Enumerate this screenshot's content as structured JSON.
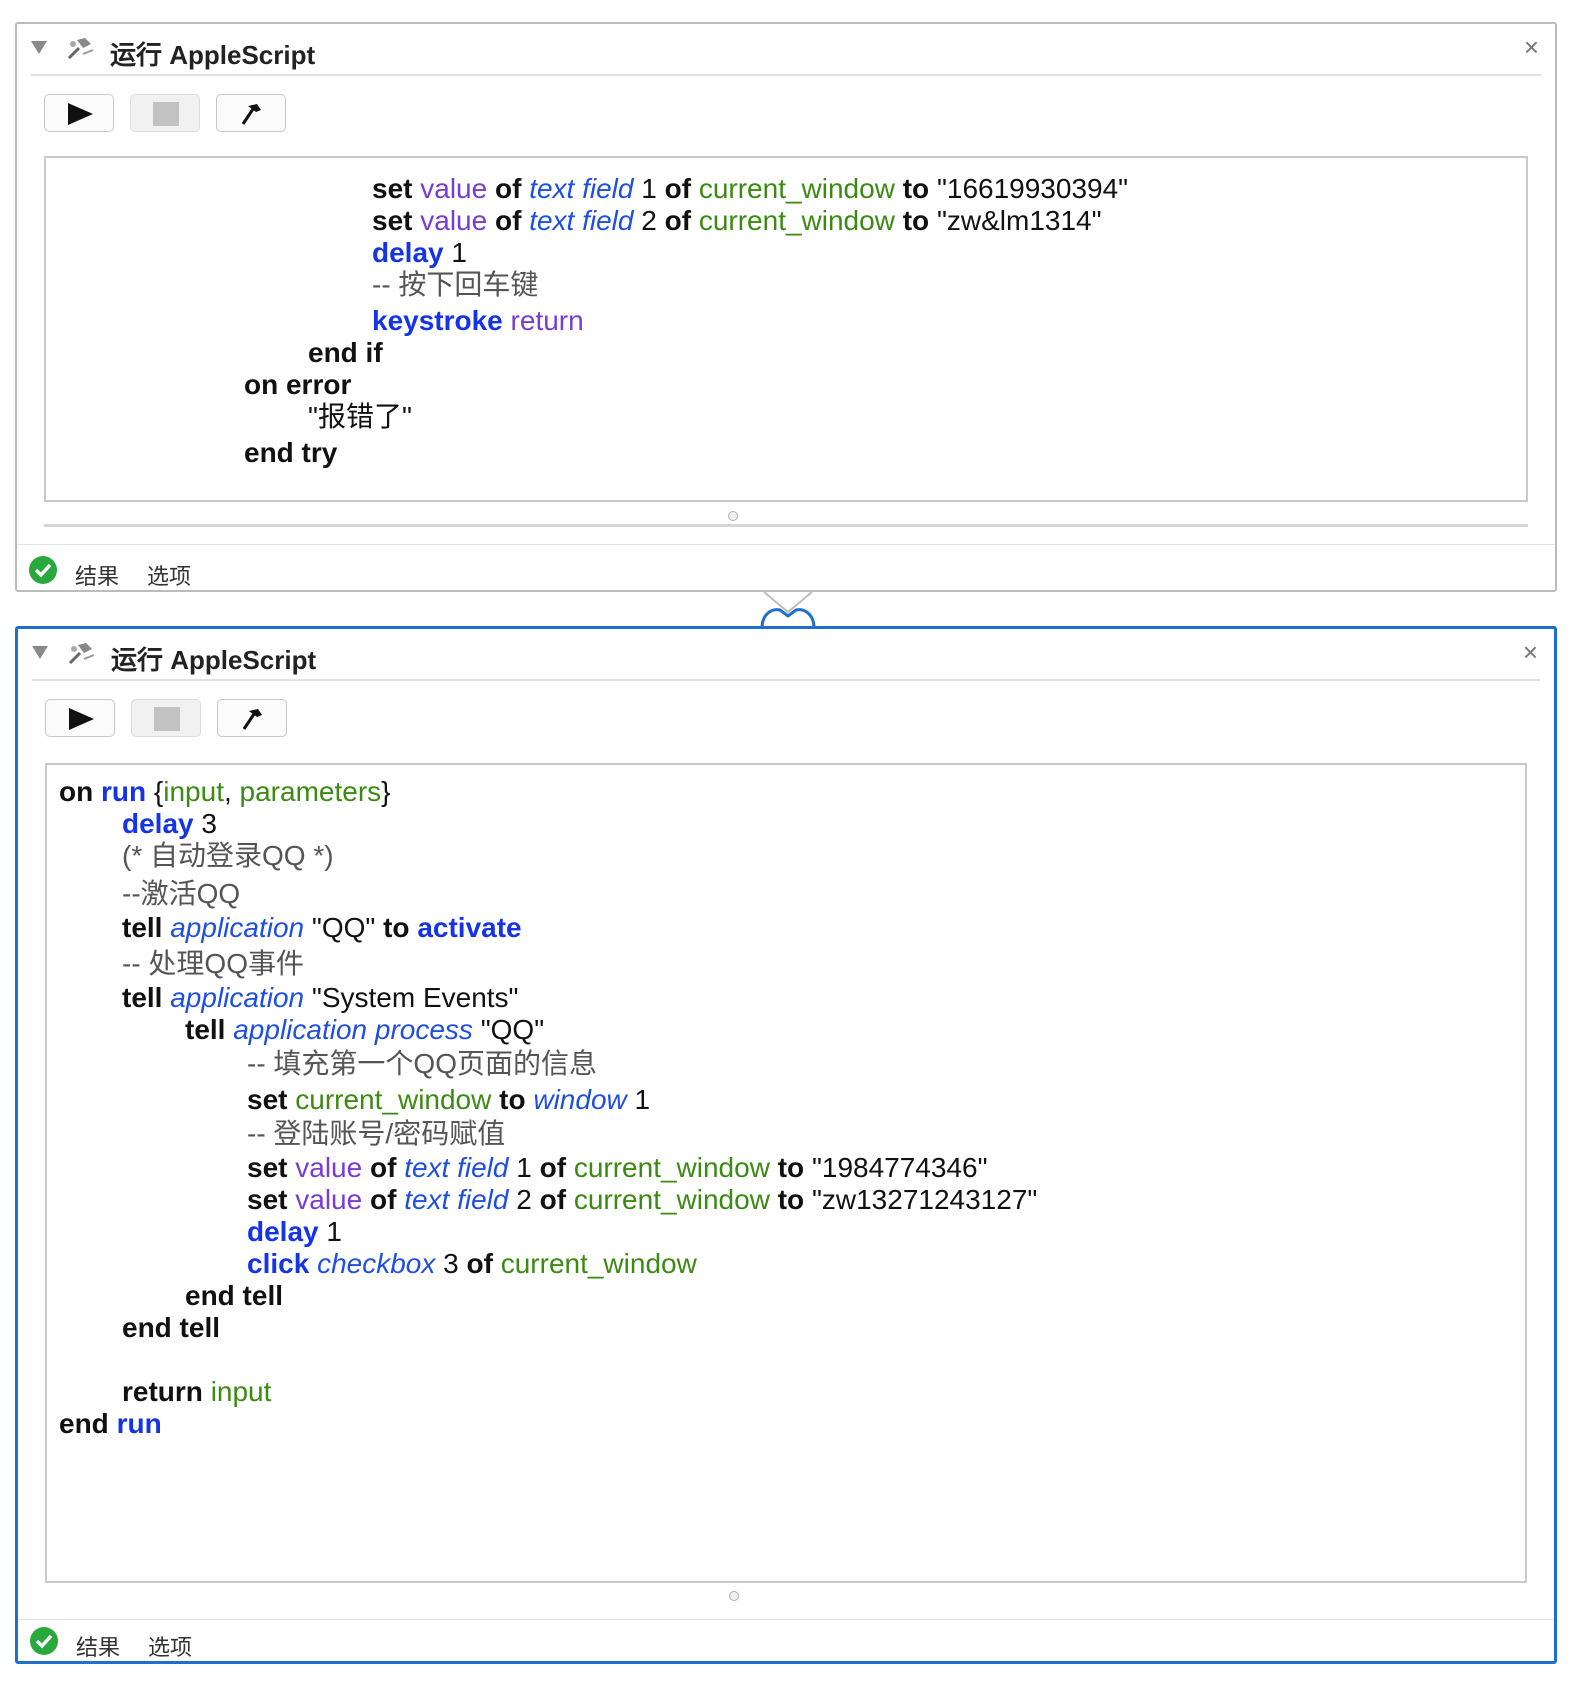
{
  "panels": [
    {
      "title": "运行 AppleScript",
      "footer": {
        "result_tab": "结果",
        "options_tab": "选项"
      },
      "lines": [
        [
          {
            "t": "set ",
            "c": "kw"
          },
          {
            "t": "value",
            "c": "prop"
          },
          {
            "t": " of ",
            "c": "kw"
          },
          {
            "t": "text field",
            "c": "cls"
          },
          {
            "t": " 1 ",
            "c": "num"
          },
          {
            "t": "of ",
            "c": "kw"
          },
          {
            "t": "current_window",
            "c": "var"
          },
          {
            "t": " to ",
            "c": "kw"
          },
          {
            "t": "\"16619930394\"",
            "c": "str"
          }
        ],
        [
          {
            "t": "set ",
            "c": "kw"
          },
          {
            "t": "value",
            "c": "prop"
          },
          {
            "t": " of ",
            "c": "kw"
          },
          {
            "t": "text field",
            "c": "cls"
          },
          {
            "t": " 2 ",
            "c": "num"
          },
          {
            "t": "of ",
            "c": "kw"
          },
          {
            "t": "current_window",
            "c": "var"
          },
          {
            "t": " to ",
            "c": "kw"
          },
          {
            "t": "\"zw&lm1314\"",
            "c": "str"
          }
        ],
        [
          {
            "t": "delay",
            "c": "cmd"
          },
          {
            "t": " 1",
            "c": "num"
          }
        ],
        [
          {
            "t": "-- 按下回车键",
            "c": "comment"
          }
        ],
        [
          {
            "t": "keystroke",
            "c": "cmd"
          },
          {
            "t": " return",
            "c": "prop"
          }
        ],
        [
          {
            "t": "end if",
            "c": "kw"
          }
        ],
        [
          {
            "t": "on error",
            "c": "kw"
          }
        ],
        [
          {
            "t": "\"报错了\"",
            "c": "str"
          }
        ],
        [
          {
            "t": "end try",
            "c": "kw"
          }
        ]
      ]
    },
    {
      "title": "运行 AppleScript",
      "footer": {
        "result_tab": "结果",
        "options_tab": "选项"
      },
      "lines": [
        [
          {
            "t": "on ",
            "c": "kw"
          },
          {
            "t": "run",
            "c": "cmd"
          },
          {
            "t": " {",
            "c": "plain"
          },
          {
            "t": "input",
            "c": "var"
          },
          {
            "t": ", ",
            "c": "plain"
          },
          {
            "t": "parameters",
            "c": "var"
          },
          {
            "t": "}",
            "c": "plain"
          }
        ],
        [
          {
            "t": "delay",
            "c": "cmd"
          },
          {
            "t": " 3",
            "c": "num"
          }
        ],
        [
          {
            "t": "(* 自动登录QQ *)",
            "c": "comment"
          }
        ],
        [
          {
            "t": "--激活QQ",
            "c": "comment"
          }
        ],
        [
          {
            "t": "tell ",
            "c": "kw"
          },
          {
            "t": "application",
            "c": "cls"
          },
          {
            "t": " \"QQ\" ",
            "c": "str"
          },
          {
            "t": "to ",
            "c": "kw"
          },
          {
            "t": "activate",
            "c": "cmd"
          }
        ],
        [
          {
            "t": "-- 处理QQ事件",
            "c": "comment"
          }
        ],
        [
          {
            "t": "tell ",
            "c": "kw"
          },
          {
            "t": "application",
            "c": "cls"
          },
          {
            "t": " \"System Events\"",
            "c": "str"
          }
        ],
        [
          {
            "t": "tell ",
            "c": "kw"
          },
          {
            "t": "application process",
            "c": "cls"
          },
          {
            "t": " \"QQ\"",
            "c": "str"
          }
        ],
        [
          {
            "t": "-- 填充第一个QQ页面的信息",
            "c": "comment"
          }
        ],
        [
          {
            "t": "set ",
            "c": "kw"
          },
          {
            "t": "current_window",
            "c": "var"
          },
          {
            "t": " to ",
            "c": "kw"
          },
          {
            "t": "window",
            "c": "cls"
          },
          {
            "t": " 1",
            "c": "num"
          }
        ],
        [
          {
            "t": "-- 登陆账号/密码赋值",
            "c": "comment"
          }
        ],
        [
          {
            "t": "set ",
            "c": "kw"
          },
          {
            "t": "value",
            "c": "prop"
          },
          {
            "t": " of ",
            "c": "kw"
          },
          {
            "t": "text field",
            "c": "cls"
          },
          {
            "t": " 1 ",
            "c": "num"
          },
          {
            "t": "of ",
            "c": "kw"
          },
          {
            "t": "current_window",
            "c": "var"
          },
          {
            "t": " to ",
            "c": "kw"
          },
          {
            "t": "\"1984774346\"",
            "c": "str"
          }
        ],
        [
          {
            "t": "set ",
            "c": "kw"
          },
          {
            "t": "value",
            "c": "prop"
          },
          {
            "t": " of ",
            "c": "kw"
          },
          {
            "t": "text field",
            "c": "cls"
          },
          {
            "t": " 2 ",
            "c": "num"
          },
          {
            "t": "of ",
            "c": "kw"
          },
          {
            "t": "current_window",
            "c": "var"
          },
          {
            "t": " to ",
            "c": "kw"
          },
          {
            "t": "\"zw13271243127\"",
            "c": "str"
          }
        ],
        [
          {
            "t": "delay",
            "c": "cmd"
          },
          {
            "t": " 1",
            "c": "num"
          }
        ],
        [
          {
            "t": "click ",
            "c": "cmd"
          },
          {
            "t": "checkbox",
            "c": "cls"
          },
          {
            "t": " 3 ",
            "c": "num"
          },
          {
            "t": "of ",
            "c": "kw"
          },
          {
            "t": "current_window",
            "c": "var"
          }
        ],
        [
          {
            "t": "end tell",
            "c": "kw"
          }
        ],
        [
          {
            "t": "end tell",
            "c": "kw"
          }
        ],
        [
          {
            "t": "return ",
            "c": "kw"
          },
          {
            "t": "input",
            "c": "var"
          }
        ],
        [
          {
            "t": "end ",
            "c": "kw"
          },
          {
            "t": "run",
            "c": "cmd"
          }
        ]
      ]
    }
  ]
}
